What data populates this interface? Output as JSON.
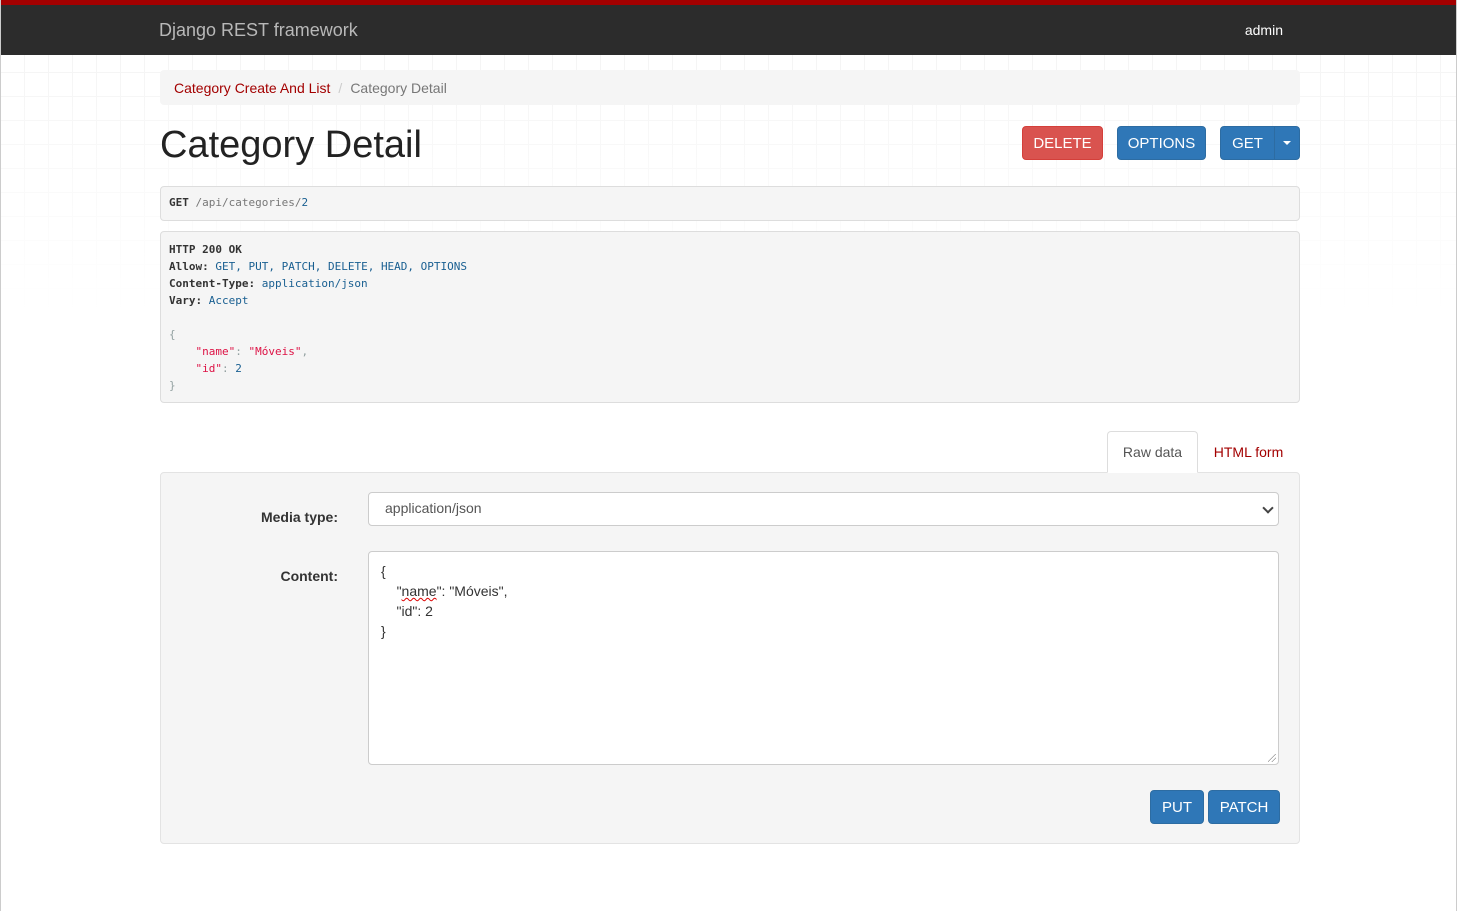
{
  "navbar": {
    "brand": "Django REST framework",
    "user": "admin"
  },
  "breadcrumb": {
    "items": [
      {
        "label": "Category Create And List"
      },
      {
        "label": "Category Detail"
      }
    ],
    "separator": "/"
  },
  "page": {
    "title": "Category Detail"
  },
  "actions": {
    "delete_label": "DELETE",
    "options_label": "OPTIONS",
    "get_label": "GET"
  },
  "request": {
    "method": "GET",
    "path": "/api/categories/",
    "id": "2"
  },
  "response": {
    "status_line": "HTTP 200 OK",
    "headers": [
      {
        "name": "Allow:",
        "value": "GET, PUT, PATCH, DELETE, HEAD, OPTIONS"
      },
      {
        "name": "Content-Type:",
        "value": "application/json"
      },
      {
        "name": "Vary:",
        "value": "Accept"
      }
    ],
    "body": {
      "open": "{",
      "close": "}",
      "name_key": "\"name\"",
      "name_value": "\"Móveis\"",
      "id_key": "\"id\"",
      "id_value": "2"
    }
  },
  "tabs": {
    "raw_label": "Raw data",
    "html_label": "HTML form"
  },
  "form": {
    "media_type_label": "Media type:",
    "media_type_value": "application/json",
    "content_label": "Content:",
    "content_lines": {
      "l1": "{",
      "l2a": "\"",
      "l2b": "name",
      "l2c": "\": \"Móveis\",",
      "l3": "    \"id\": 2",
      "l4": "}"
    },
    "put_label": "PUT",
    "patch_label": "PATCH"
  },
  "colors": {
    "brand_red": "#a30000",
    "primary": "#2f77b7",
    "danger": "#d9534f",
    "navbar": "#2c2c2c"
  }
}
